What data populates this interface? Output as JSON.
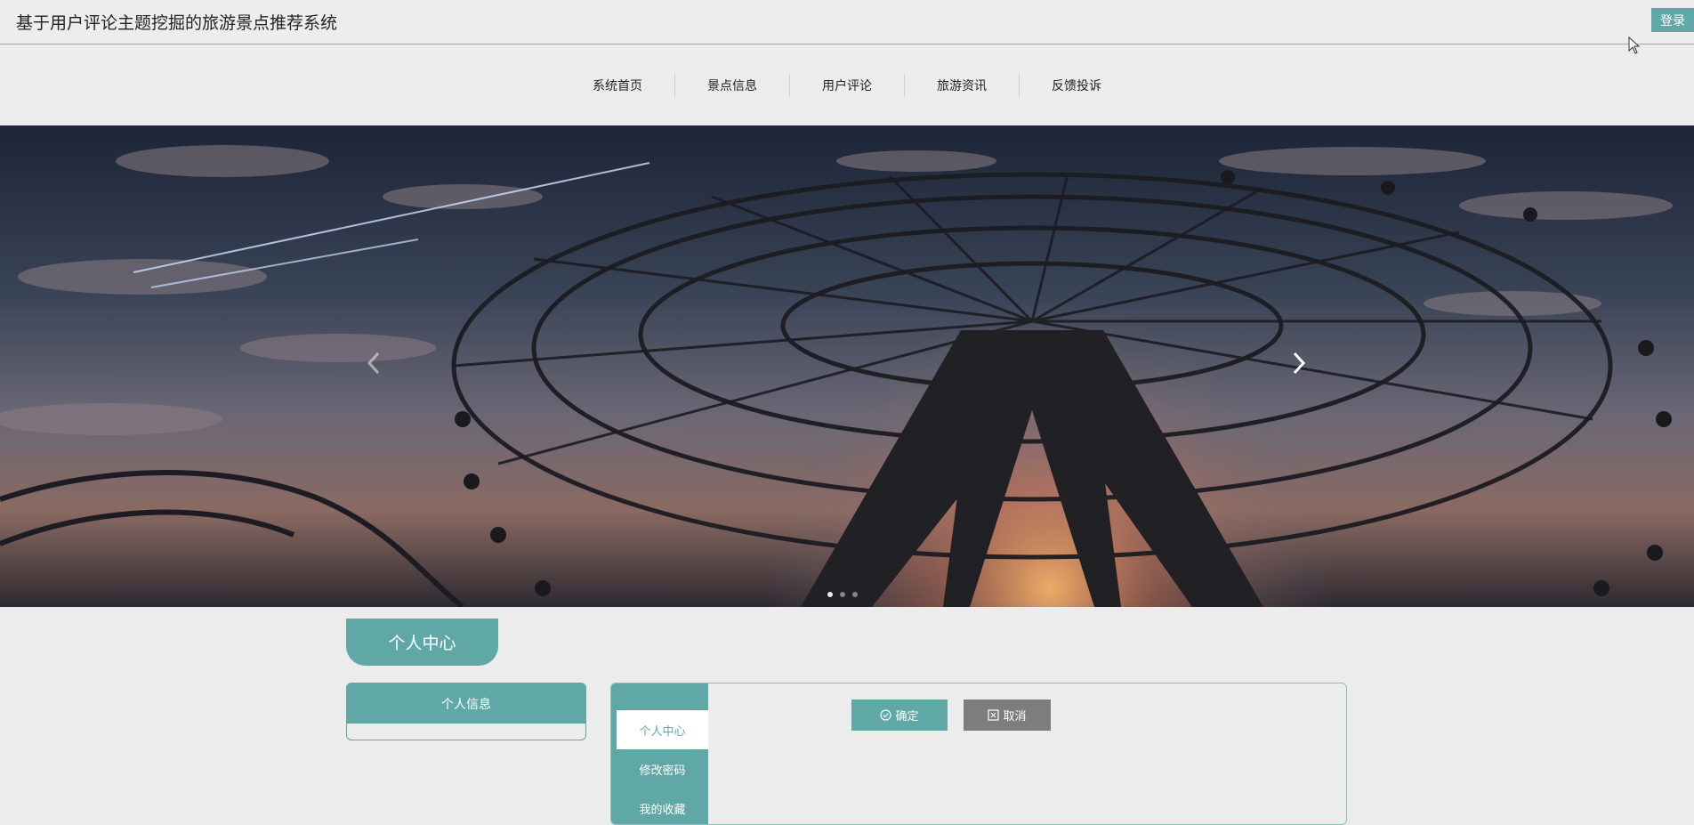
{
  "header": {
    "title": "基于用户评论主题挖掘的旅游景点推荐系统",
    "login_label": "登录"
  },
  "nav": {
    "items": [
      {
        "label": "系统首页"
      },
      {
        "label": "景点信息"
      },
      {
        "label": "用户评论"
      },
      {
        "label": "旅游资讯"
      },
      {
        "label": "反馈投诉"
      }
    ]
  },
  "carousel": {
    "prev_icon": "chevron-left-icon",
    "next_icon": "chevron-right-icon",
    "dot_count": 3,
    "active_dot": 0
  },
  "center": {
    "title": "个人中心",
    "left_panel_title": "个人信息",
    "tabs": [
      {
        "label": "个人中心"
      },
      {
        "label": "修改密码"
      },
      {
        "label": "我的收藏"
      }
    ],
    "confirm_label": "确定",
    "cancel_label": "取消"
  },
  "colors": {
    "accent": "#5fa8a6",
    "cancel": "#7d7d7d",
    "background": "#ececec"
  }
}
